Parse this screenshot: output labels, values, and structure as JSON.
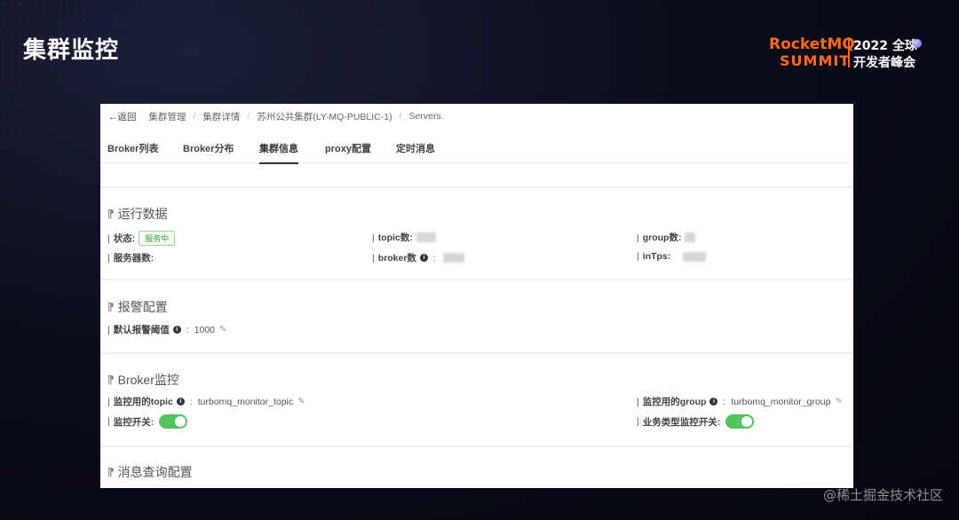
{
  "slide": {
    "title": "集群监控",
    "logo": {
      "line1": "RocketMQ",
      "line2": "SUMMIT",
      "right1": "2022 全球",
      "right2": "开发者峰会"
    },
    "watermark": "@稀土掘金技术社区"
  },
  "breadcrumb": {
    "back": "←返回",
    "items": [
      "集群管理",
      "集群详情",
      "苏州公共集群(LY-MQ-PUBLIC-1)",
      "Servers."
    ]
  },
  "tabs": [
    "Broker列表",
    "Broker分布",
    "集群信息",
    "proxy配置",
    "定时消息"
  ],
  "active_tab": "集群信息",
  "sections": {
    "runtime": {
      "title": "运行数据",
      "status_label": "状态:",
      "status_value": "服务中",
      "topic_label": "topic数:",
      "group_label": "group数:",
      "servers_label": "服务器数:",
      "broker_label": "broker数",
      "intps_label": "inTps:"
    },
    "alarm": {
      "title": "报警配置",
      "threshold_label": "默认报警阈值",
      "threshold_value": "1000"
    },
    "broker_monitor": {
      "title": "Broker监控",
      "topic_label": "监控用的topic",
      "topic_value": "turbomq_monitor_topic",
      "group_label": "监控用的group",
      "group_value": "turbomq_monitor_group",
      "switch_label": "监控开关:",
      "biz_switch_label": "业务类型监控开关:",
      "switch_on": true,
      "biz_switch_on": true
    },
    "query": {
      "title": "消息查询配置"
    }
  },
  "colors": {
    "accent_orange": "#ff6a1a",
    "toggle_on": "#52c45a",
    "badge_green": "#3aa63a"
  }
}
